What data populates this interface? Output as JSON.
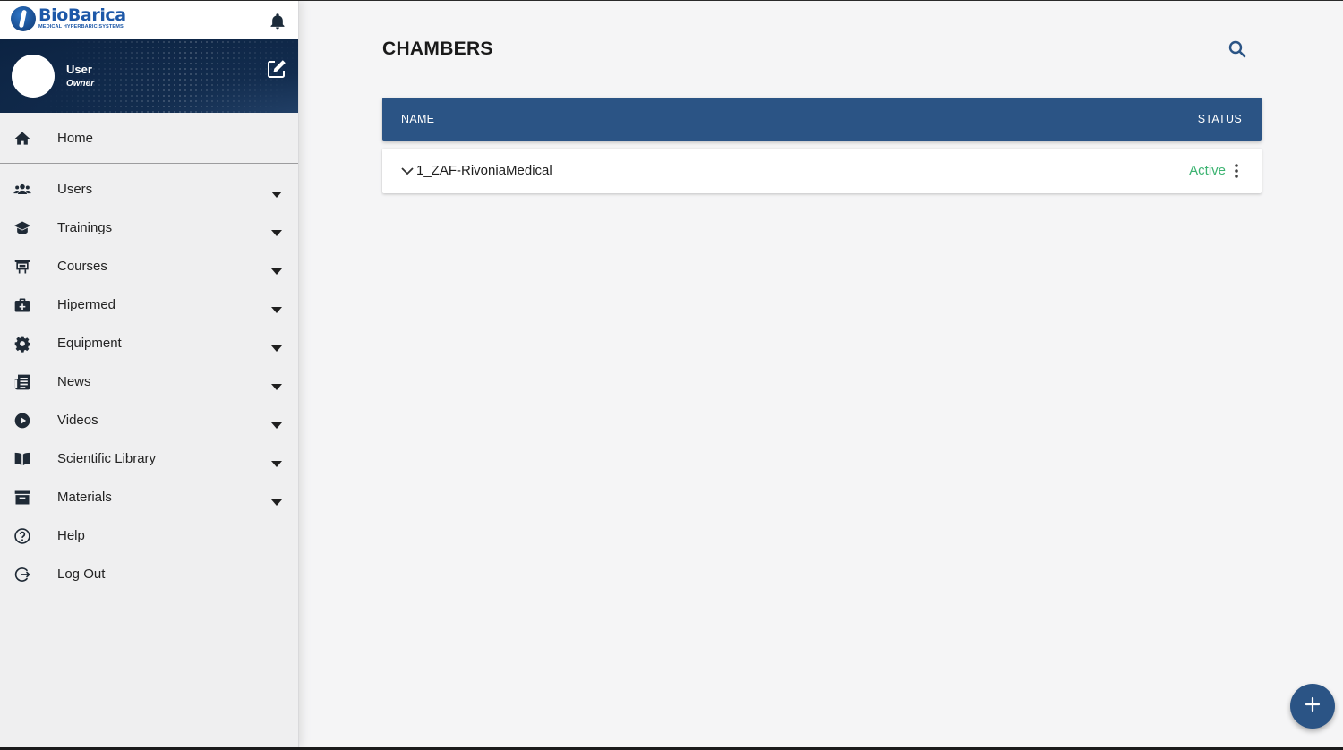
{
  "brand": {
    "name": "BioBarica",
    "tagline": "MEDICAL HYPERBARIC SYSTEMS",
    "icon": "biobarica-logo"
  },
  "header": {
    "notifications_icon": "bell-icon"
  },
  "profile": {
    "name": "User",
    "role": "Owner",
    "edit_icon": "edit-icon"
  },
  "sidebar": {
    "home": {
      "label": "Home",
      "icon": "home-icon"
    },
    "items": [
      {
        "label": "Users",
        "icon": "users-icon",
        "expandable": true
      },
      {
        "label": "Trainings",
        "icon": "graduation-cap-icon",
        "expandable": true
      },
      {
        "label": "Courses",
        "icon": "chalkboard-icon",
        "expandable": true
      },
      {
        "label": "Hipermed",
        "icon": "medical-kit-icon",
        "expandable": true
      },
      {
        "label": "Equipment",
        "icon": "gear-icon",
        "expandable": true
      },
      {
        "label": "News",
        "icon": "newspaper-icon",
        "expandable": true
      },
      {
        "label": "Videos",
        "icon": "play-icon",
        "expandable": true
      },
      {
        "label": "Scientific Library",
        "icon": "book-icon",
        "expandable": true
      },
      {
        "label": "Materials",
        "icon": "archive-box-icon",
        "expandable": true
      },
      {
        "label": "Help",
        "icon": "help-icon",
        "expandable": false
      },
      {
        "label": "Log Out",
        "icon": "logout-icon",
        "expandable": false
      }
    ]
  },
  "main": {
    "title": "CHAMBERS",
    "search_icon": "search-icon",
    "table": {
      "columns": [
        "NAME",
        "STATUS"
      ],
      "rows": [
        {
          "name": "1_ZAF-RivoniaMedical",
          "status": "Active"
        }
      ]
    },
    "add_icon": "plus-icon"
  },
  "colors": {
    "primary": "#2b5485",
    "profile_bg": "#0c2342",
    "active_status": "#3cb371",
    "sidebar_bg": "#efeff0",
    "page_bg": "#f5f5f6"
  }
}
